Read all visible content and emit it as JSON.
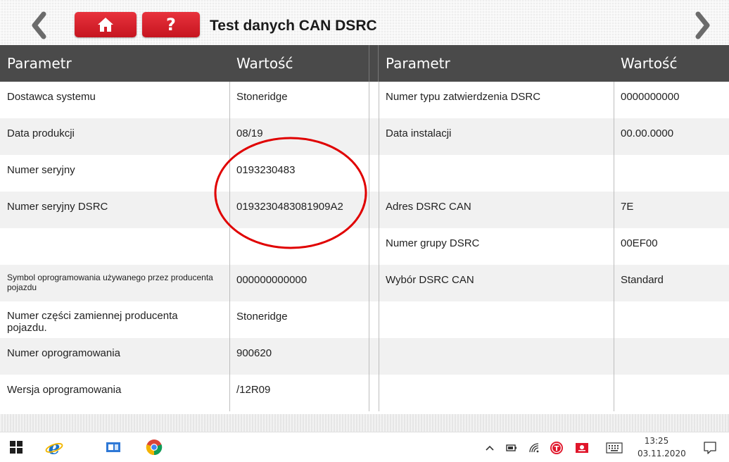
{
  "header": {
    "title": "Test danych CAN DSRC",
    "help_label": "?"
  },
  "colors": {
    "accent_red": "#d71f2a",
    "header_bg": "#4a4a4a",
    "row_alt": "#f1f1f1",
    "annotation_circle": "#e00000"
  },
  "icons": [
    "chevron-left-icon",
    "home-icon",
    "chevron-right-icon",
    "windows-start-icon",
    "internet-explorer-icon",
    "file-explorer-icon",
    "chrome-icon",
    "chevron-up-icon",
    "battery-icon",
    "wifi-icon",
    "red-t-app-icon",
    "red-app-icon",
    "keyboard-icon",
    "notification-icon"
  ],
  "table": {
    "headers": [
      "Parametr",
      "Wartość",
      "Parametr",
      "Wartość"
    ],
    "rows": [
      {
        "p1": "Dostawca systemu",
        "v1": "Stoneridge",
        "p2": "Numer typu zatwierdzenia DSRC",
        "v2": "0000000000"
      },
      {
        "p1": "Data produkcji",
        "v1": "08/19",
        "p2": "Data instalacji",
        "v2": "00.00.0000"
      },
      {
        "p1": "Numer seryjny",
        "v1": "0193230483",
        "p2": "",
        "v2": ""
      },
      {
        "p1": "Numer seryjny DSRC",
        "v1": "0193230483081909A2",
        "p2": "Adres DSRC CAN",
        "v2": "7E"
      },
      {
        "p1": "",
        "v1": "",
        "p2": "Numer grupy DSRC",
        "v2": "00EF00"
      },
      {
        "p1": "Symbol oprogramowania używanego przez producenta pojazdu",
        "v1": "000000000000",
        "p2": "Wybór DSRC CAN",
        "v2": "Standard"
      },
      {
        "p1": "Numer części zamiennej producenta pojazdu.",
        "v1": "Stoneridge",
        "p2": "",
        "v2": ""
      },
      {
        "p1": "Numer oprogramowania",
        "v1": "900620",
        "p2": "",
        "v2": ""
      },
      {
        "p1": "Wersja oprogramowania",
        "v1": "/12R09",
        "p2": "",
        "v2": ""
      }
    ]
  },
  "taskbar": {
    "time": "13:25",
    "date": "03.11.2020"
  }
}
